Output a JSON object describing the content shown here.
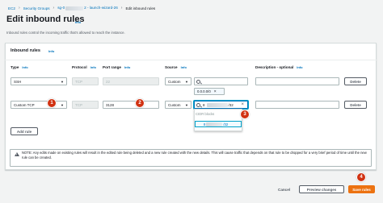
{
  "breadcrumb": {
    "ec2": "EC2",
    "security_groups": "Security Groups",
    "sg_prefix": "sg-0",
    "sg_suffix": "2 - launch-wizard-26",
    "current": "Edit inbound rules",
    "separator": "›"
  },
  "page": {
    "title": "Edit inbound rules",
    "info": "Info",
    "subtitle": "Inbound rules control the incoming traffic that's allowed to reach the instance."
  },
  "panel": {
    "title": "Inbound rules",
    "info": "Info",
    "columns": {
      "type": "Type",
      "protocol": "Protocol",
      "port_range": "Port range",
      "source": "Source",
      "description": "Description - optional",
      "info": "Info"
    }
  },
  "rows": [
    {
      "type": "SSH",
      "protocol": "TCP",
      "port_range": "22",
      "source": "Custom",
      "search_value": "",
      "token": "0.0.0.0/0",
      "description": "",
      "delete": "Delete"
    },
    {
      "type": "Custom TCP",
      "protocol": "TCP",
      "port_range": "3128",
      "source": "Custom",
      "search_prefix": "8",
      "search_suffix": "/32",
      "description": "",
      "delete": "Delete"
    }
  ],
  "dropdown": {
    "header": "CIDR blocks",
    "item_prefix": "8",
    "item_suffix": "/32"
  },
  "add_rule": "Add rule",
  "warning": "NOTE: Any edits made on existing rules will result in the edited rule being deleted and a new rule created with the new details. This will cause traffic that depends on that rule to be dropped for a very brief period of time until the new rule can be created.",
  "footer": {
    "cancel": "Cancel",
    "preview": "Preview changes",
    "save": "Save rules"
  },
  "markers": [
    "1",
    "2",
    "3",
    "4"
  ],
  "icons": {
    "search": "search-icon",
    "clear": "close-icon",
    "caret": "caret-down-icon",
    "warning": "warning-icon"
  },
  "colors": {
    "link": "#0073bb",
    "primary": "#ec7211",
    "marker": "#d13212",
    "focus": "#00a1c9"
  }
}
